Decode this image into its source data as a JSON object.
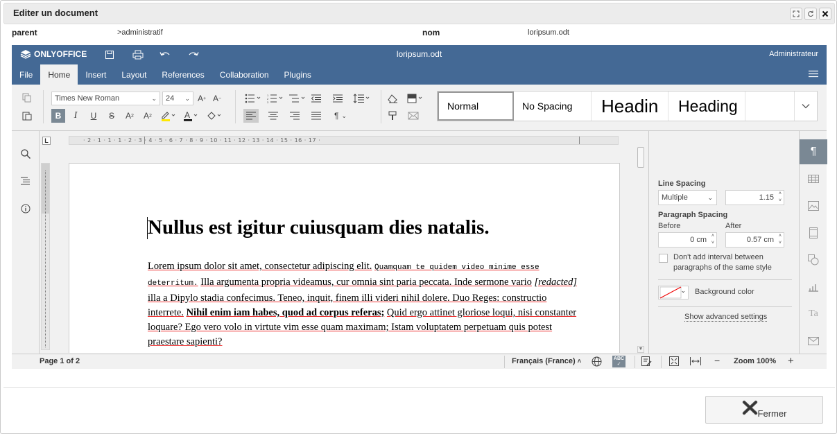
{
  "dialog": {
    "title": "Editer un document",
    "close_label": "Fermer"
  },
  "meta": {
    "parent_label": "parent",
    "parent_value": ">administratif",
    "nom_label": "nom",
    "nom_value": "loripsum.odt"
  },
  "editor": {
    "brand": "ONLYOFFICE",
    "doc_title": "loripsum.odt",
    "user": "Administrateur",
    "tabs": [
      "File",
      "Home",
      "Insert",
      "Layout",
      "References",
      "Collaboration",
      "Plugins"
    ],
    "active_tab": "Home",
    "font_name": "Times New Roman",
    "font_size": "24",
    "styles": [
      "Normal",
      "No Spacing",
      "Headin",
      "Heading"
    ]
  },
  "ruler": {
    "marks": "· 2 · 1 · 1 · 1 · 2 · 3 · 4 · 5 · 6 · 7 · 8 · 9 · 10 · 11 · 12 · 13 · 14 · 15 · 16 · 17 ·"
  },
  "document": {
    "heading": "Nullus est igitur cuiusquam dies natalis.",
    "p": {
      "a1": "Lorem ipsum dolor sit amet, consectetur adipiscing elit.",
      "a2": "Quamquam te quidem video minime esse deterritum.",
      "a3": "Illa argumenta propria videamus, cur omnia sint paria peccata. Inde sermone vario",
      "a4": "[redacted]",
      "a5": "illa a Dipylo stadia confecimus. Teneo, inquit, finem illi videri nihil dolere. Duo Reges: constructio interrete.",
      "a6": "Nihil enim iam habes, quod ad corpus referas;",
      "a7": "Quid ergo attinet gloriose loqui, nisi constanter loquare? Ego vero volo in virtute vim esse quam maximam; Istam voluptatem perpetuam quis potest praestare sapienti?"
    }
  },
  "panel": {
    "line_spacing_label": "Line Spacing",
    "line_spacing_mode": "Multiple",
    "line_spacing_value": "1.15",
    "paragraph_spacing_label": "Paragraph Spacing",
    "before_label": "Before",
    "before_value": "0 cm",
    "after_label": "After",
    "after_value": "0.57 cm",
    "dont_add_interval": "Don't add interval between paragraphs of the same style",
    "background_color_label": "Background color",
    "advanced_link": "Show advanced settings"
  },
  "status": {
    "page": "Page 1 of 2",
    "language": "Français (France)",
    "zoom": "Zoom 100%"
  },
  "colors": {
    "header": "#446995",
    "accent_active_tool": "#7a8894",
    "spell_underline": "#e33333"
  }
}
